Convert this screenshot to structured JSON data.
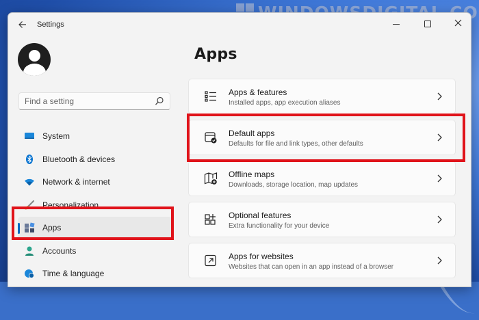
{
  "watermark": {
    "text": "WINDOWSDIGITAL.COM"
  },
  "window": {
    "title": "Settings",
    "back_icon": "arrow-left-icon",
    "controls": [
      "minimize-icon",
      "maximize-icon",
      "close-icon"
    ]
  },
  "sidebar": {
    "search": {
      "placeholder": "Find a setting",
      "value": ""
    },
    "items": [
      {
        "label": "System",
        "icon": "monitor-icon",
        "color": "#0078d4"
      },
      {
        "label": "Bluetooth & devices",
        "icon": "bluetooth-icon",
        "color": "#0078d4"
      },
      {
        "label": "Network & internet",
        "icon": "wifi-icon",
        "color": "#0078d4"
      },
      {
        "label": "Personalization",
        "icon": "brush-icon",
        "color": "#e3a23b"
      },
      {
        "label": "Apps",
        "icon": "apps-icon",
        "color": "#5c6b8a",
        "active": true
      },
      {
        "label": "Accounts",
        "icon": "person-icon",
        "color": "#2ca58d"
      },
      {
        "label": "Time & language",
        "icon": "globe-clock-icon",
        "color": "#0078d4"
      }
    ]
  },
  "main": {
    "title": "Apps",
    "cards": [
      {
        "title": "Apps & features",
        "desc": "Installed apps, app execution aliases",
        "icon": "list-icon"
      },
      {
        "title": "Default apps",
        "desc": "Defaults for file and link types, other defaults",
        "icon": "default-apps-icon"
      },
      {
        "title": "Offline maps",
        "desc": "Downloads, storage location, map updates",
        "icon": "map-icon"
      },
      {
        "title": "Optional features",
        "desc": "Extra functionality for your device",
        "icon": "add-grid-icon"
      },
      {
        "title": "Apps for websites",
        "desc": "Websites that can open in an app instead of a browser",
        "icon": "open-in-app-icon"
      }
    ]
  },
  "colors": {
    "accent": "#0067c0",
    "highlight": "#e0131a",
    "window_bg": "#f3f3f3",
    "card_bg": "#fbfbfb"
  }
}
